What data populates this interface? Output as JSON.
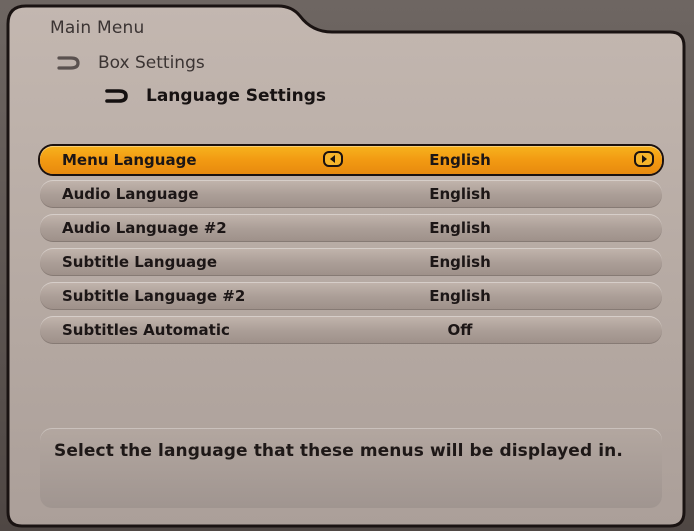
{
  "breadcrumb": {
    "main": "Main Menu",
    "level2": "Box Settings",
    "level3": "Language Settings"
  },
  "settings": [
    {
      "label": "Menu Language",
      "value": "English",
      "selected": true
    },
    {
      "label": "Audio Language",
      "value": "English",
      "selected": false
    },
    {
      "label": "Audio Language #2",
      "value": "English",
      "selected": false
    },
    {
      "label": "Subtitle Language",
      "value": "English",
      "selected": false
    },
    {
      "label": "Subtitle Language #2",
      "value": "English",
      "selected": false
    },
    {
      "label": "Subtitles Automatic",
      "value": "Off",
      "selected": false
    }
  ],
  "help": {
    "text": "Select the language that these menus will be displayed in."
  },
  "icons": {
    "breadcrumb_arrow": "return-arrow-icon",
    "left_arrow": "left-arrow-button-icon",
    "right_arrow": "right-arrow-button-icon"
  },
  "colors": {
    "panel": "#b9aca5",
    "highlight": "#f29a12",
    "row": "#aa9d96",
    "text": "#1c1616"
  }
}
